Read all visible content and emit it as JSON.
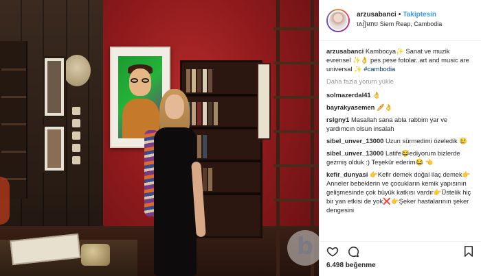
{
  "post": {
    "username": "arzusabanci",
    "follow_label": "Takiptesin",
    "location": "សៀមរាប Siem Reap, Cambodia",
    "watermark_letter": "b"
  },
  "caption": {
    "username": "arzusabanci",
    "text": "Kambocya✨ Sanat ve muzik evrensel ✨👌 pes pese fotolar..art and music are universal ✨",
    "hashtag": "#cambodia"
  },
  "load_more_label": "Daha fazla yorum yükle",
  "comments": [
    {
      "user": "solmazerdal41",
      "text": "👌"
    },
    {
      "user": "bayrakyasemen",
      "text": "🥖👌"
    },
    {
      "user": "rslgny1",
      "text": "Masallah sana abla rabbim yar ve yardımcın olsun insalah"
    },
    {
      "user": "sibel_unver_13000",
      "text": "Uzun sürmedimi özeledik 😢"
    },
    {
      "user": "sibel_unver_13000",
      "text": "Latife😂ediyorum bizlerde gezmiş olduk :) Teşekür ederim😂 👈"
    },
    {
      "user": "kefir_dunyasi",
      "text": "👉Kefir demek doğal ilaç demek👉Anneler bebeklerin ve çocukların kemik yapısının gelişmesinde çok büyük katkısı vardır👉Üstelik hiç bir yan etkisi de yok❌👉Şeker hastalarının şeker dengesini"
    }
  ],
  "actions": {
    "like_icon": "heart-icon",
    "comment_icon": "comment-icon",
    "save_icon": "bookmark-icon"
  },
  "likes_label": "6.498 beğenme",
  "colors": {
    "link_blue": "#3897f0",
    "hashtag": "#003569",
    "wall_red": "#8e1a1c"
  }
}
